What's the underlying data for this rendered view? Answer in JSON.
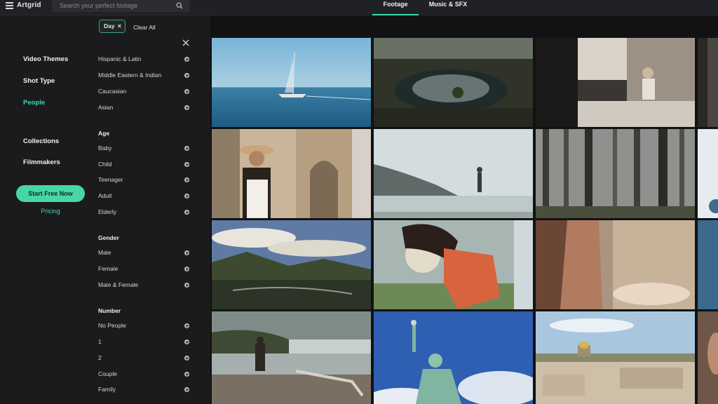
{
  "app": {
    "logo": "Artgrid"
  },
  "search": {
    "placeholder": "Search your perfect footage"
  },
  "tabs": [
    {
      "label": "Footage",
      "active": true
    },
    {
      "label": "Music & SFX",
      "active": false
    }
  ],
  "nav": {
    "items": [
      {
        "label": "Video Themes",
        "active": false
      },
      {
        "label": "Shot Type",
        "active": false
      },
      {
        "label": "People",
        "active": true
      },
      {
        "label": "Collections",
        "active": false
      },
      {
        "label": "Filmmakers",
        "active": false
      }
    ],
    "cta": "Start Free Now",
    "pricing": "Pricing"
  },
  "filters": {
    "chips": [
      {
        "label": "Day",
        "remove": "×"
      }
    ],
    "clear_all": "Clear All",
    "ethnicity": [
      "Hispanic & Latin",
      "Middle Eastern & Indian",
      "Caucasian",
      "Asian"
    ],
    "age": {
      "title": "Age",
      "options": [
        "Baby",
        "Child",
        "Teenager",
        "Adult",
        "Elderly"
      ]
    },
    "gender": {
      "title": "Gender",
      "options": [
        "Male",
        "Female",
        "Male & Female"
      ]
    },
    "number": {
      "title": "Number",
      "options": [
        "No People",
        "1",
        "2",
        "Couple",
        "Family"
      ]
    }
  },
  "colors": {
    "accent": "#45d7aa",
    "background": "#1b1b1d",
    "topbar": "#202124"
  },
  "icons": {
    "menu": "hamburger-icon",
    "search": "search-icon",
    "close": "close-icon",
    "add": "plus-circle-icon"
  }
}
